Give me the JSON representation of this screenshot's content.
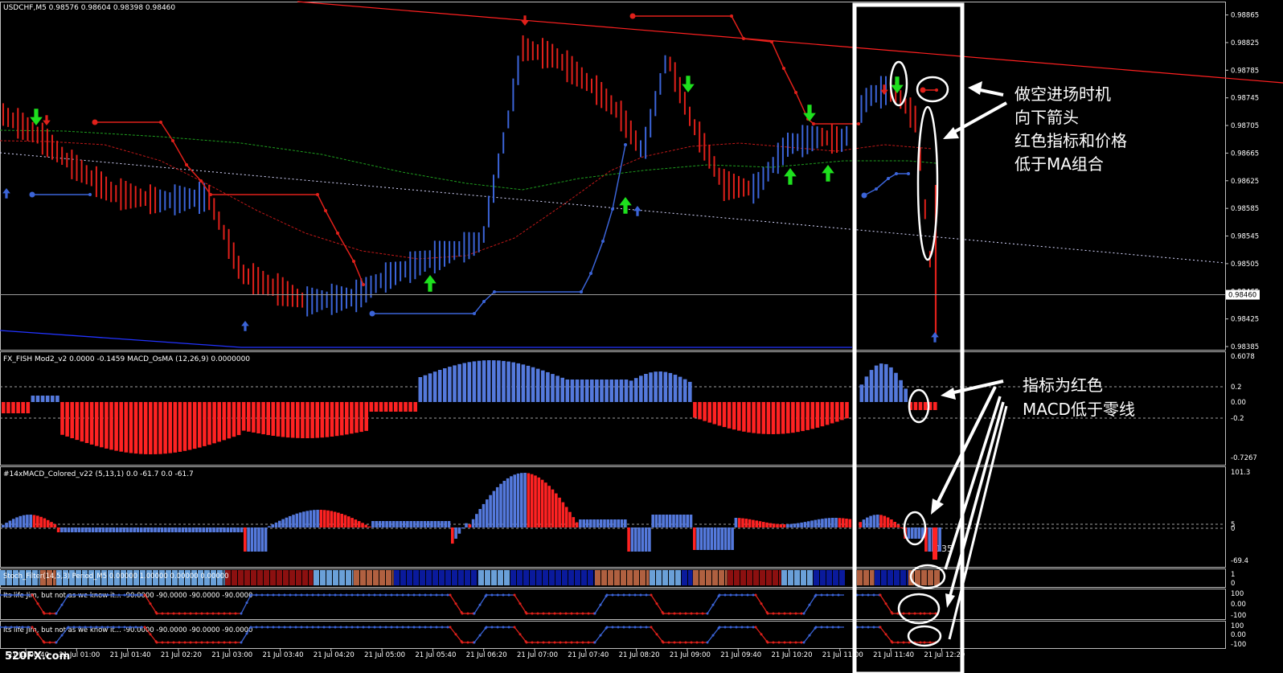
{
  "window": {
    "symbol_title": "USDCHF,M5  0.98576 0.98604 0.98398 0.98460"
  },
  "colors": {
    "bull": "#3b64d8",
    "bear": "#e0201a",
    "hist_blue": "#5479dc",
    "hist_red": "#ff2222",
    "ma_green": "#1e9e1e",
    "ma_red": "#c01818",
    "ma_blue_dotted": "#9aa6ff",
    "arrow_green": "#1ee01e",
    "grid_dashed": "#a0a0a0",
    "stoch_light": "#6aa0d8",
    "stoch_dark_blue": "#0a1a9c",
    "stoch_brown": "#8c1010",
    "stoch_orange": "#b06040"
  },
  "price_axis": {
    "ticks": [
      "0.98865",
      "0.98825",
      "0.98785",
      "0.98745",
      "0.98705",
      "0.98665",
      "0.98625",
      "0.98585",
      "0.98545",
      "0.98505",
      "0.98465",
      "0.98425",
      "0.98385"
    ],
    "current": "0.98460",
    "range": [
      0.98385,
      0.98875
    ]
  },
  "time_axis": {
    "labels": [
      "21 Jul 00:40",
      "21 Jul 01:00",
      "21 Jul 01:40",
      "21 Jul 02:20",
      "21 Jul 03:00",
      "21 Jul 03:40",
      "21 Jul 04:20",
      "21 Jul 05:00",
      "21 Jul 05:40",
      "21 Jul 06:20",
      "21 Jul 07:00",
      "21 Jul 07:40",
      "21 Jul 08:20",
      "21 Jul 09:00",
      "21 Jul 09:40",
      "21 Jul 10:20",
      "21 Jul 11:00",
      "21 Jul 11:40",
      "21 Jul 12:20"
    ]
  },
  "watermark": "520FX.com",
  "panels": {
    "fish": {
      "title": "FX_FISH Mod2_v2 0.0000 -0.1459  MACD_OsMA (12,26,9) 0.0000000",
      "ticks": [
        "0.6078",
        "0.2",
        "0.00",
        "-0.2",
        "-0.7267"
      ]
    },
    "macd": {
      "title": "#14xMACD_Colored_v22 (5,13,1) 0.0 -61.7 0.0 -61.7",
      "ticks": [
        "101.3",
        "5",
        "0",
        "-69.4"
      ],
      "value_label": "-135"
    },
    "stoch": {
      "title": "Stoch_Filter(14,5,3)  Period_M5 0.00000 1.00000 0.00000 0.00000",
      "ticks": [
        "1",
        "0"
      ]
    },
    "jim1": {
      "title": "Its life Jim, but not as we know it... -90.0000 -90.0000 -90.0000 -90.0000",
      "ticks": [
        "100",
        "0.00",
        "-100"
      ]
    },
    "jim2": {
      "title": "Its life Jim, but not as we know it... -90.0000 -90.0000 -90.0000 -90.0000",
      "ticks": [
        "100",
        "0.00",
        "-100"
      ]
    }
  },
  "annotations": {
    "main_note": [
      "做空进场时机",
      "向下箭头",
      "红色指标和价格",
      "低于MA组合"
    ],
    "indicator_note": [
      "指标为红色",
      "MACD低于零线"
    ]
  },
  "chart_data": {
    "type": "bar",
    "title": "USDCHF,M5  0.98576 0.98604 0.98398 0.98460",
    "xlabel": "",
    "ylabel": "",
    "ylim": [
      0.98385,
      0.98875
    ],
    "series": [
      {
        "name": "",
        "values": [
          0.9862,
          0.9866,
          0.9869,
          0.9867,
          0.9864,
          0.986,
          0.9857,
          0.9858,
          0.9856,
          0.9852,
          0.9849,
          0.9849,
          0.9848,
          0.9849,
          0.9851,
          0.9853,
          0.9858,
          0.9866,
          0.9882,
          0.988,
          0.9878,
          0.9875,
          0.9872,
          0.9862,
          0.9858,
          0.9868,
          0.9874,
          0.9863,
          0.9862,
          0.9866,
          0.9867,
          0.9866,
          0.9862,
          0.9863,
          0.9865,
          0.9876,
          0.9852,
          0.9846
        ]
      }
    ]
  }
}
